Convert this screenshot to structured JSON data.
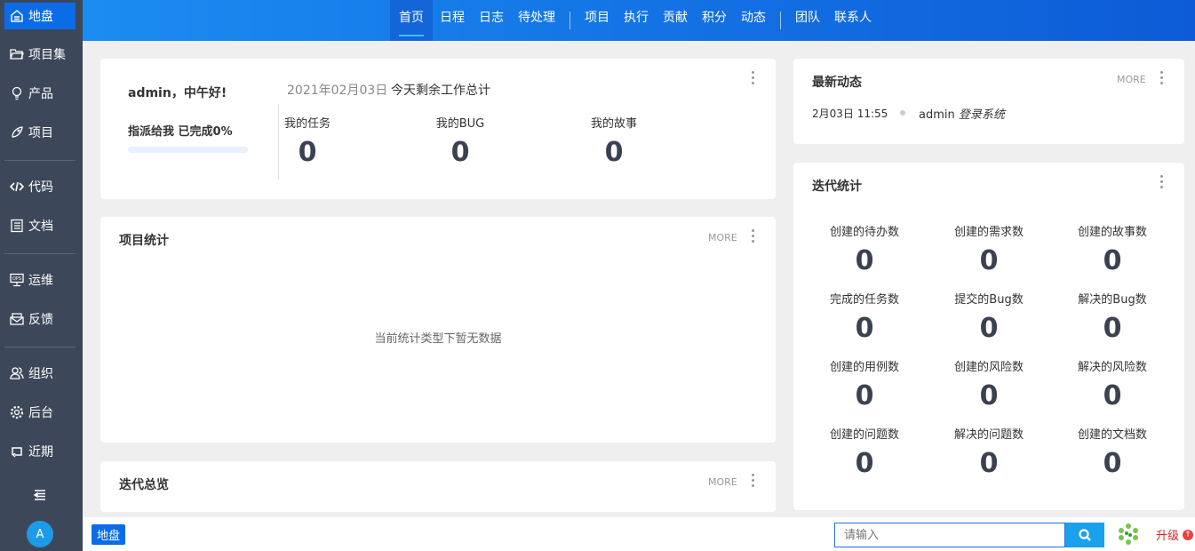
{
  "sidebar": {
    "items": [
      {
        "label": "地盘",
        "icon": "home-icon"
      },
      {
        "label": "项目集",
        "icon": "folder-icon"
      },
      {
        "label": "产品",
        "icon": "lightbulb-icon"
      },
      {
        "label": "项目",
        "icon": "rocket-icon"
      },
      {
        "label": "代码",
        "icon": "code-icon"
      },
      {
        "label": "文档",
        "icon": "document-icon"
      },
      {
        "label": "运维",
        "icon": "ops-monitor-icon"
      },
      {
        "label": "反馈",
        "icon": "feedback-icon"
      },
      {
        "label": "组织",
        "icon": "users-icon"
      },
      {
        "label": "后台",
        "icon": "gear-icon"
      },
      {
        "label": "近期",
        "icon": "repeat-icon"
      }
    ],
    "avatar": "A"
  },
  "nav": {
    "group1": [
      "首页",
      "日程",
      "日志",
      "待处理"
    ],
    "group2": [
      "项目",
      "执行",
      "贡献",
      "积分",
      "动态"
    ],
    "group3": [
      "团队",
      "联系人"
    ]
  },
  "welcome": {
    "greeting": "admin，中午好!",
    "assigned": "指派给我 已完成0%",
    "progress": 0,
    "date": "2021年02月03日",
    "summary": "今天剩余工作总计",
    "stats": [
      {
        "label": "我的任务",
        "value": "0"
      },
      {
        "label": "我的BUG",
        "value": "0"
      },
      {
        "label": "我的故事",
        "value": "0"
      }
    ]
  },
  "project_stats": {
    "title": "项目统计",
    "more": "MORE",
    "empty": "当前统计类型下暂无数据"
  },
  "iteration_overview": {
    "title": "迭代总览",
    "more": "MORE"
  },
  "latest": {
    "title": "最新动态",
    "more": "MORE",
    "items": [
      {
        "time": "2月03日 11:55",
        "user": "admin",
        "action": "登录系统"
      }
    ]
  },
  "iteration_stats": {
    "title": "迭代统计",
    "items": [
      {
        "label": "创建的待办数",
        "value": "0"
      },
      {
        "label": "创建的需求数",
        "value": "0"
      },
      {
        "label": "创建的故事数",
        "value": "0"
      },
      {
        "label": "完成的任务数",
        "value": "0"
      },
      {
        "label": "提交的Bug数",
        "value": "0"
      },
      {
        "label": "解决的Bug数",
        "value": "0"
      },
      {
        "label": "创建的用例数",
        "value": "0"
      },
      {
        "label": "创建的风险数",
        "value": "0"
      },
      {
        "label": "解决的风险数",
        "value": "0"
      },
      {
        "label": "创建的问题数",
        "value": "0"
      },
      {
        "label": "解决的问题数",
        "value": "0"
      },
      {
        "label": "创建的文档数",
        "value": "0"
      }
    ]
  },
  "bottom": {
    "tag": "地盘",
    "search_placeholder": "请输入",
    "upgrade": "升级"
  }
}
